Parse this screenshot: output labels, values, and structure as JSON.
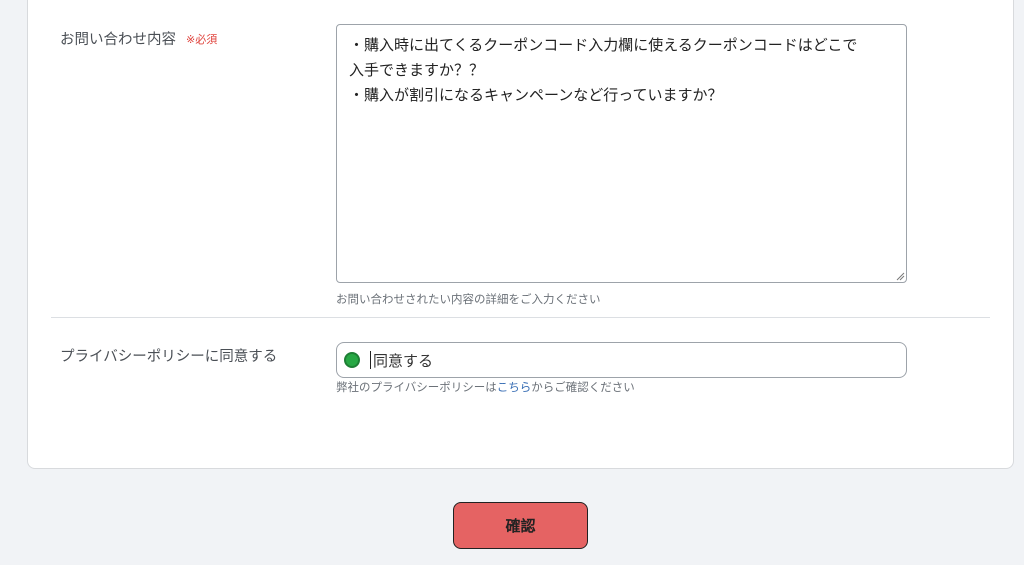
{
  "inquiry": {
    "label": "お問い合わせ内容",
    "required": "※必須",
    "content": "・購入時に出てくるクーポンコード入力欄に使えるクーポンコードはどこで\n入手できますか？？\n・購入が割引になるキャンペーンなど行っていますか？",
    "help": "お問い合わせされたい内容の詳細をご入力ください"
  },
  "privacy": {
    "label": "プライバシーポリシーに同意する",
    "option": "同意する",
    "help_prefix": "弊社のプライバシーポリシーは",
    "help_link": "こちら",
    "help_suffix": "からご確認ください"
  },
  "confirm_button": "確認",
  "colors": {
    "required": "#e0453f",
    "confirm_button": "#e56363",
    "radio_checked": "#27a844",
    "link": "#3a6fb5"
  }
}
